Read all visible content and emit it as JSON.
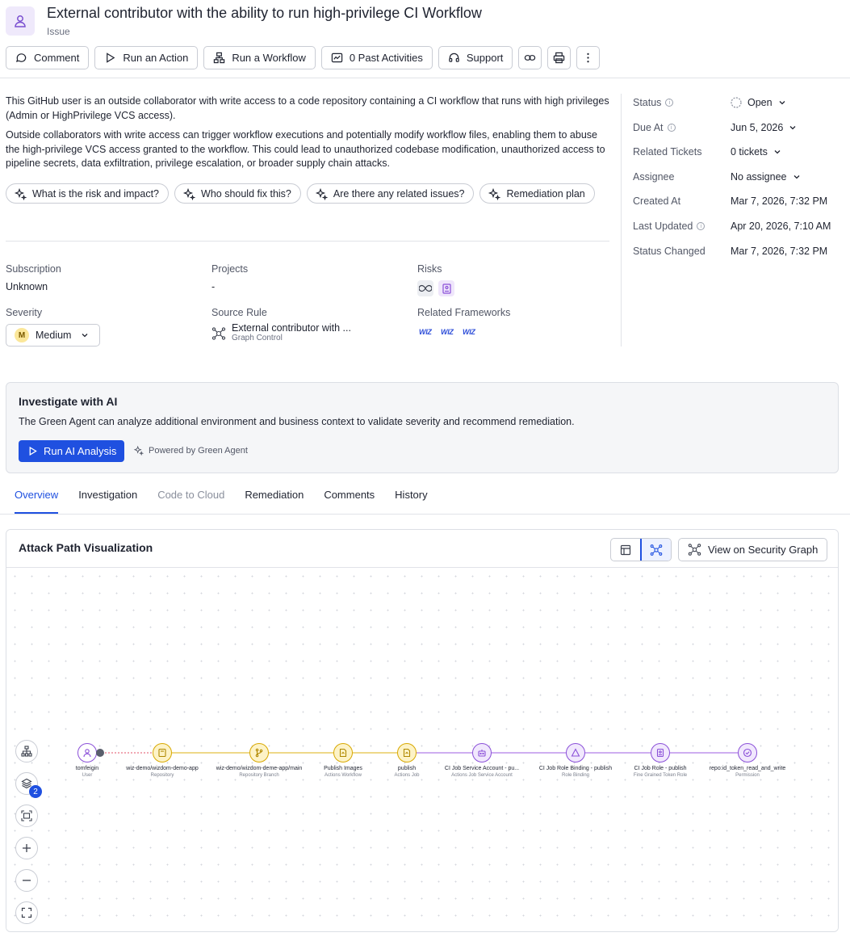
{
  "header": {
    "title": "External contributor with the ability to run high-privilege CI Workflow",
    "subtitle": "Issue"
  },
  "toolbar": {
    "comment": "Comment",
    "run_action": "Run an Action",
    "run_workflow": "Run a Workflow",
    "past_activities": "0 Past Activities",
    "support": "Support"
  },
  "description": {
    "p1": "This GitHub user is an outside collaborator with write access to a code repository containing a CI workflow that runs with high privileges (Admin or HighPrivilege VCS access).",
    "p2": "Outside collaborators with write access can trigger workflow executions and potentially modify workflow files, enabling them to abuse the high-privilege VCS access granted to the workflow. This could lead to unauthorized codebase modification, unauthorized access to pipeline secrets, data exfiltration, privilege escalation, or broader supply chain attacks."
  },
  "chips": [
    "What is the risk and impact?",
    "Who should fix this?",
    "Are there any related issues?",
    "Remediation plan"
  ],
  "props": {
    "subscription_label": "Subscription",
    "subscription_value": "Unknown",
    "projects_label": "Projects",
    "projects_value": "-",
    "risks_label": "Risks",
    "severity_label": "Severity",
    "severity_badge": "M",
    "severity_value": "Medium",
    "source_rule_label": "Source Rule",
    "source_rule_value": "External contributor with ...",
    "source_rule_type": "Graph Control",
    "frameworks_label": "Related Frameworks",
    "wiz": "WIZ"
  },
  "panel": {
    "status_label": "Status",
    "status_value": "Open",
    "due_label": "Due At",
    "due_value": "Jun 5, 2026",
    "tickets_label": "Related Tickets",
    "tickets_value": "0 tickets",
    "assignee_label": "Assignee",
    "assignee_value": "No assignee",
    "created_label": "Created At",
    "created_value": "Mar 7, 2026, 7:32 PM",
    "updated_label": "Last Updated",
    "updated_value": "Apr 20, 2026, 7:10 AM",
    "status_changed_label": "Status Changed",
    "status_changed_value": "Mar 7, 2026, 7:32 PM"
  },
  "ai": {
    "title": "Investigate with AI",
    "text": "The Green Agent can analyze additional environment and business context to validate severity and recommend remediation.",
    "button": "Run AI Analysis",
    "powered": "Powered by Green Agent"
  },
  "tabs": [
    "Overview",
    "Investigation",
    "Code to Cloud",
    "Remediation",
    "Comments",
    "History"
  ],
  "attack_path": {
    "title": "Attack Path Visualization",
    "view_graph": "View on Security Graph",
    "layers_count": "2",
    "nodes": [
      {
        "name": "tomfeigin",
        "type": "User"
      },
      {
        "name": "wiz-demo/wizdom-demo-app",
        "type": "Repository"
      },
      {
        "name": "wiz-demo/wizdom-deme-app/main",
        "type": "Repository Branch"
      },
      {
        "name": "Publish Images",
        "type": "Actions Workflow"
      },
      {
        "name": "publish",
        "type": "Actions Job"
      },
      {
        "name": "CI Job Service Account - pu...",
        "type": "Actions Job Service Account"
      },
      {
        "name": "CI Job Role Binding - publish",
        "type": "Role Binding"
      },
      {
        "name": "CI Job Role - publish",
        "type": "Fine Grained Token Role"
      },
      {
        "name": "repo:id_token_read_and_write",
        "type": "Permission"
      }
    ]
  },
  "colors": {
    "accent": "#1f50e0",
    "user_node": "#8a4fd8",
    "repo_node": "#d8a800",
    "identity_node": "#8a4fd8"
  }
}
